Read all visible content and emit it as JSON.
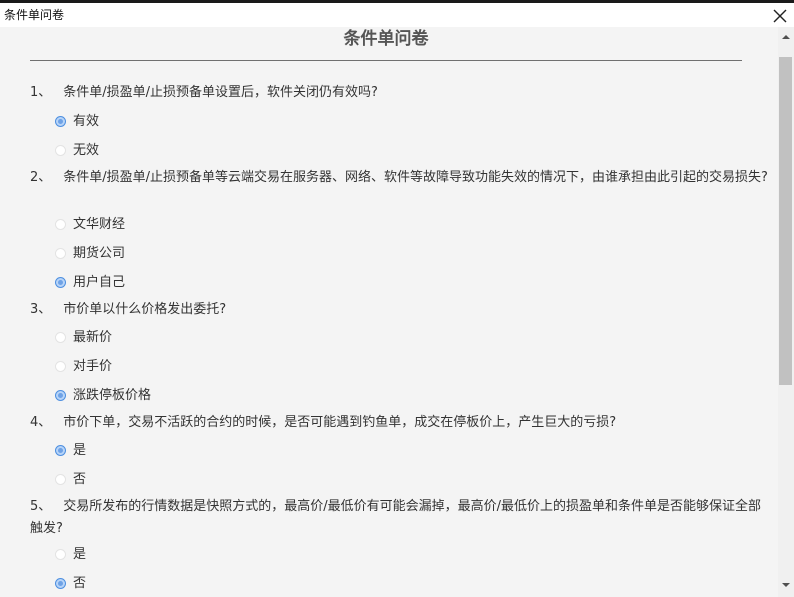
{
  "window": {
    "title": "条件单问卷",
    "close_icon": "close-icon"
  },
  "page": {
    "heading": "条件单问卷"
  },
  "questions": [
    {
      "number": "1、",
      "text": "条件单/损盈单/止损预备单设置后，软件关闭仍有效吗?",
      "options": [
        {
          "label": "有效",
          "selected": true
        },
        {
          "label": "无效",
          "selected": false
        }
      ]
    },
    {
      "number": "2、",
      "text": "条件单/损盈单/止损预备单等云端交易在服务器、网络、软件等故障导致功能失效的情况下，由谁承担由此引起的交易损失?",
      "options": [
        {
          "label": "文华财经",
          "selected": false
        },
        {
          "label": "期货公司",
          "selected": false
        },
        {
          "label": "用户自己",
          "selected": true
        }
      ]
    },
    {
      "number": "3、",
      "text": "市价单以什么价格发出委托?",
      "options": [
        {
          "label": "最新价",
          "selected": false
        },
        {
          "label": "对手价",
          "selected": false
        },
        {
          "label": "涨跌停板价格",
          "selected": true
        }
      ]
    },
    {
      "number": "4、",
      "text": "市价下单，交易不活跃的合约的时候，是否可能遇到钓鱼单，成交在停板价上，产生巨大的亏损?",
      "options": [
        {
          "label": "是",
          "selected": true
        },
        {
          "label": "否",
          "selected": false
        }
      ]
    },
    {
      "number": "5、",
      "text": "交易所发布的行情数据是快照方式的，最高价/最低价有可能会漏掉，最高价/最低价上的损盈单和条件单是否能够保证全部触发?",
      "options": [
        {
          "label": "是",
          "selected": false
        },
        {
          "label": "否",
          "selected": true
        }
      ]
    }
  ],
  "colors": {
    "background": "#f4f4f4",
    "text": "#333333",
    "heading": "#555555",
    "radio_selected": "#6ea2e6"
  }
}
